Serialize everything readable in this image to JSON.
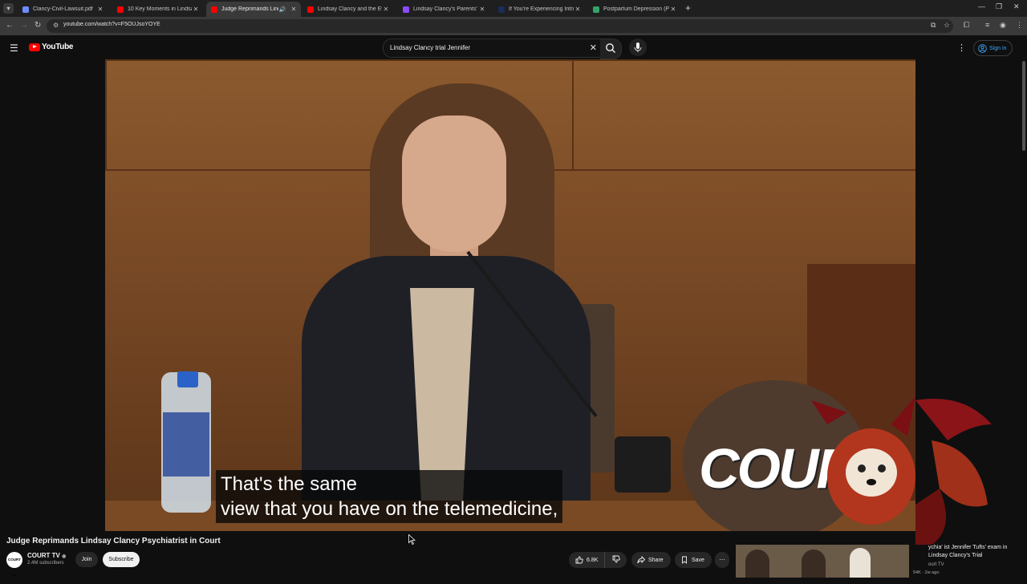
{
  "browser": {
    "tabs": [
      {
        "title": "Clancy-Civil-Lawsuit.pdf",
        "favicon_color": "#6c8cff",
        "active": false
      },
      {
        "title": "10 Key Moments in Lindsay Cla",
        "favicon_color": "#ff0000",
        "active": false
      },
      {
        "title": "Judge Reprimands Lindsay",
        "favicon_color": "#ff0000",
        "active": true,
        "audio": "🔊"
      },
      {
        "title": "Lindsay Clancy and the Eviden",
        "favicon_color": "#ff0000",
        "active": false
      },
      {
        "title": "Lindsay Clancy's Parents' $1 Mi",
        "favicon_color": "#8a4bff",
        "active": false
      },
      {
        "title": "If You're Experiencing Intrusive",
        "favicon_color": "#1a2c5a",
        "active": false
      },
      {
        "title": "Postpartum Depression (PPD)",
        "favicon_color": "#34a36b",
        "active": false
      }
    ],
    "url": "youtube.com/watch?v=F5OUJsoYOYE"
  },
  "youtube": {
    "logo_text": "YouTube",
    "search_query": "Lindsay Clancy trial Jennifer",
    "signin_label": "Sign in"
  },
  "video": {
    "caption_line1": "That's the same",
    "caption_line2": "view that you have on the telemedicine,",
    "watermark": "COURT",
    "title": "Judge Reprimands Lindsay Clancy Psychiatrist in Court",
    "channel_logo_text": "COURT TV",
    "channel": "COURT TV",
    "subscribers": "2.4M subscribers",
    "join_label": "Join",
    "subscribe_label": "Subscribe",
    "likes": "6.8K",
    "share_label": "Share",
    "save_label": "Save"
  },
  "recommended": {
    "title": "ychia' ist Jennifer Tufts' exam in Lindsay Clancy's Trial",
    "channel": "ourt TV",
    "meta": "54K · 2w ago"
  },
  "colors": {
    "youtube_red": "#ff0000",
    "link_blue": "#3ea6ff",
    "background": "#0f0f0f"
  }
}
